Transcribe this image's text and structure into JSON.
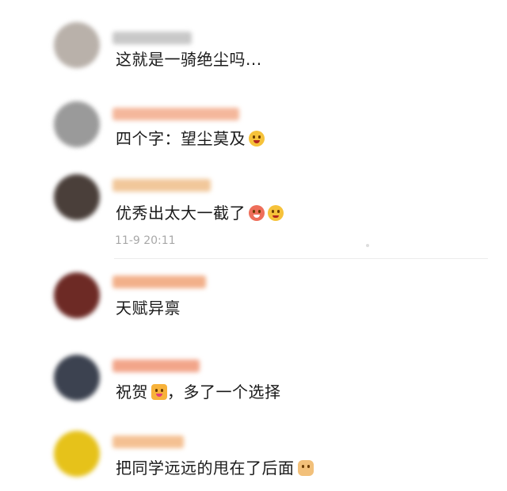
{
  "comments": [
    {
      "text": "这就是一骑绝尘吗...",
      "emojis": [],
      "avatar_color": "#b9b1aa",
      "nick_color": "#c8c8c8"
    },
    {
      "text": "四个字：望尘莫及",
      "emojis": [
        "scared-face-emoji"
      ],
      "avatar_color": "#9a9a9a",
      "nick_color": "#f4b79b"
    },
    {
      "text": "优秀出太大一截了",
      "emojis": [
        "drooling-face-emoji",
        "embarrassed-face-emoji"
      ],
      "avatar_color": "#4a3f3a",
      "nick_color": "#f1c79a"
    },
    {
      "text": "天赋异禀",
      "emojis": [],
      "avatar_color": "#6d2a25",
      "nick_color": "#f2b08a"
    },
    {
      "text": "祝贺",
      "text_after": "，多了一个选择",
      "emojis": [
        "party-popper-emoji"
      ],
      "avatar_color": "#3c4250",
      "nick_color": "#f2a58a"
    },
    {
      "text": "把同学远远的甩在了后面",
      "emojis": [
        "thumbs-up-emoji"
      ],
      "avatar_color": "#e6c21a",
      "nick_color": "#f4c092"
    }
  ],
  "timestamp": "11-9 20:11",
  "colors": {
    "emoji_yellow": "#f6c23a",
    "timestamp_gray": "#a8a8a8"
  }
}
